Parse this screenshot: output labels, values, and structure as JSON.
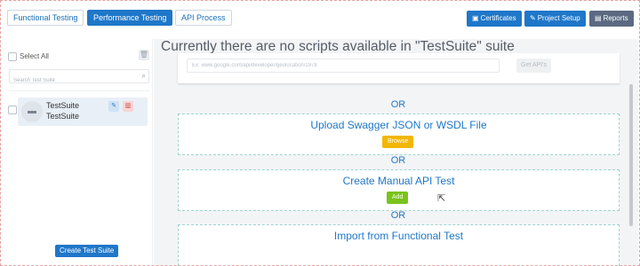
{
  "tabs": [
    {
      "label": "Functional Testing",
      "active": false
    },
    {
      "label": "Performance Testing",
      "active": true
    },
    {
      "label": "API Process",
      "active": false
    }
  ],
  "toolbar": {
    "certificates_label": "Certificates",
    "certificates_icon": "certificate-icon",
    "project_setup_label": "Project Setup",
    "project_setup_icon": "wrench-icon",
    "reports_label": "Reports",
    "reports_icon": "report-icon"
  },
  "sidebar": {
    "select_all_label": "Select All",
    "search_placeholder": "Search Test Suite",
    "suites": [
      {
        "name_line1": "TestSuite",
        "name_line2": "TestSuite"
      }
    ],
    "create_button_label": "Create Test Suite"
  },
  "main": {
    "title": "Currently there are no scripts available in \"TestSuite\" suite",
    "url_placeholder": "Ex: www.google.com/api/developer/geolocation/1978",
    "get_apis_label": "Get API's",
    "or_label": "OR",
    "upload_title": "Upload Swagger JSON or WSDL File",
    "browse_label": "Browse",
    "manual_title": "Create Manual API Test",
    "add_label": "Add",
    "import_title": "Import from Functional Test"
  },
  "colors": {
    "accent": "#1f77c9",
    "browse": "#f2b705",
    "add": "#79c31b",
    "reports": "#5b6a82"
  }
}
